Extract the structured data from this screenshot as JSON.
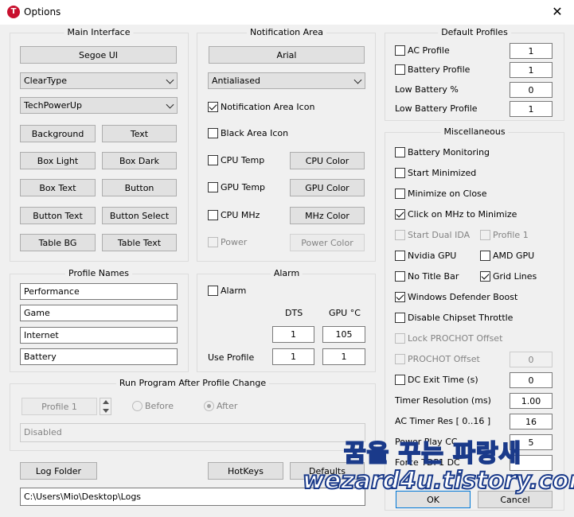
{
  "window": {
    "title": "Options",
    "app_icon": "T",
    "close_glyph": "✕"
  },
  "main_interface": {
    "title": "Main Interface",
    "font_button": "Segoe UI",
    "render_combo": "ClearType",
    "skin_combo": "TechPowerUp",
    "color_buttons": [
      "Background",
      "Text",
      "Box Light",
      "Box Dark",
      "Box Text",
      "Button",
      "Button Text",
      "Button Select",
      "Table BG",
      "Table Text"
    ]
  },
  "notification_area": {
    "title": "Notification Area",
    "font_button": "Arial",
    "render_combo": "Antialiased",
    "notification_icon": {
      "label": "Notification Area Icon",
      "checked": true
    },
    "black_icon": {
      "label": "Black Area Icon",
      "checked": false
    },
    "cpu_temp": {
      "label": "CPU Temp",
      "button": "CPU Color"
    },
    "gpu_temp": {
      "label": "GPU Temp",
      "button": "GPU Color"
    },
    "cpu_mhz": {
      "label": "CPU MHz",
      "button": "MHz Color"
    },
    "power": {
      "label": "Power",
      "button": "Power Color"
    }
  },
  "profile_names": {
    "title": "Profile Names",
    "names": [
      "Performance",
      "Game",
      "Internet",
      "Battery"
    ]
  },
  "alarm": {
    "title": "Alarm",
    "alarm_label": "Alarm",
    "col_dts": "DTS",
    "col_gpu": "GPU °C",
    "dts_value": "1",
    "gpu_value": "105",
    "use_profile_label": "Use Profile",
    "use_dts": "1",
    "use_gpu": "1"
  },
  "run_program": {
    "title": "Run Program After Profile Change",
    "profile_button": "Profile 1",
    "before": "Before",
    "after": "After",
    "status": "Disabled"
  },
  "bottom": {
    "log_folder": "Log Folder",
    "hotkeys": "HotKeys",
    "defaults": "Defaults",
    "log_path": "C:\\Users\\Mio\\Desktop\\Logs"
  },
  "default_profiles": {
    "title": "Default Profiles",
    "rows": [
      {
        "label": "AC Profile",
        "value": "1"
      },
      {
        "label": "Battery Profile",
        "value": "1"
      },
      {
        "label": "Low Battery %",
        "value": "0"
      },
      {
        "label": "Low Battery Profile",
        "value": "1"
      }
    ]
  },
  "misc": {
    "title": "Miscellaneous",
    "battery_monitoring": "Battery Monitoring",
    "start_minimized": "Start Minimized",
    "minimize_on_close": "Minimize on Close",
    "click_mhz": "Click on MHz to Minimize",
    "start_dual_ida": "Start Dual IDA",
    "profile_1": "Profile 1",
    "nvidia_gpu": "Nvidia GPU",
    "amd_gpu": "AMD GPU",
    "no_title_bar": "No Title Bar",
    "grid_lines": "Grid Lines",
    "windows_defender": "Windows Defender Boost",
    "disable_chipset": "Disable Chipset Throttle",
    "lock_prochot": "Lock PROCHOT Offset",
    "prochot_offset": "PROCHOT Offset",
    "prochot_value": "0",
    "dc_exit_time": "DC Exit Time (s)",
    "dc_exit_value": "0",
    "timer_resolution": "Timer Resolution (ms)",
    "timer_resolution_value": "1.00",
    "ac_timer_res": "AC Timer Res [ 0..16 ]",
    "ac_timer_value": "16",
    "power_play": "Power Play CC",
    "power_play_value": "5",
    "force_tdp": "Force TDP1 DC"
  },
  "dialog": {
    "ok": "OK",
    "cancel": "Cancel"
  },
  "watermark": {
    "line1": "꿈을 꾸는 파랑새",
    "line2": "wezard4u.tistory.com"
  }
}
